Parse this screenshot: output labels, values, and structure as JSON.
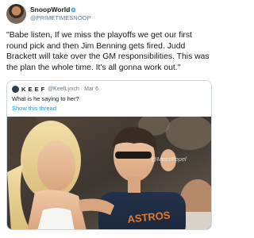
{
  "author": {
    "display_name": "SnoopWorld",
    "verified_icon": "✪",
    "handle": "@PRIMETIMESNOOP"
  },
  "tweet": {
    "text": "\"Babe listen, If we miss the playoffs we get our first round pick and then Jim Benning gets fired. Judd Brackett will take over the GM responsibilities. This was the plan the whole time. It's all gonna work out.\""
  },
  "quoted_tweet": {
    "author_name": "K E E F",
    "author_handle": "@KeefLynch",
    "date": "Mar 6",
    "text": "What is he saying to her?",
    "show_thread_label": "Show this thread",
    "media": {
      "watermark": "@MessPopel",
      "shirt_text": "ASTROS"
    }
  }
}
